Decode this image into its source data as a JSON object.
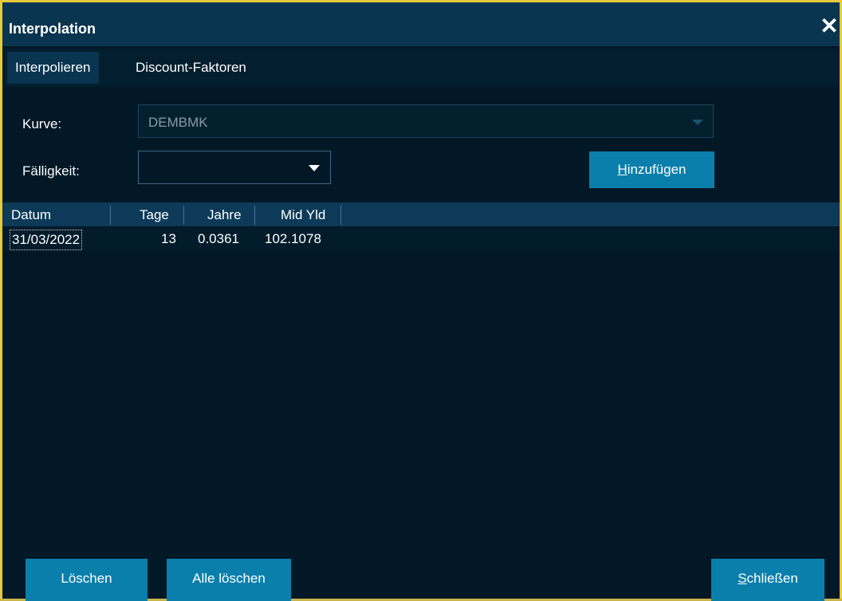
{
  "window": {
    "title": "Interpolation",
    "close_symbol": "✕"
  },
  "tabs": [
    {
      "label": "Interpolieren",
      "active": true
    },
    {
      "label": "Discount-Faktoren",
      "active": false
    }
  ],
  "form": {
    "kurve_label": "Kurve:",
    "kurve_value": "DEMBMK",
    "faelligkeit_label": "Fälligkeit:",
    "faelligkeit_value": "",
    "add_button": {
      "accel": "H",
      "rest": "inzufügen"
    }
  },
  "grid": {
    "columns": [
      "Datum",
      "Tage",
      "Jahre",
      "Mid Yld"
    ],
    "rows": [
      {
        "datum": "31/03/2022",
        "tage": "13",
        "jahre": "0.0361",
        "mid_yld": "102.1078"
      }
    ]
  },
  "footer": {
    "delete_label": "Löschen",
    "delete_all_label": "Alle löschen",
    "close_button": {
      "accel": "S",
      "rest": "chließen"
    }
  },
  "colors": {
    "window_border": "#e8c93a",
    "background": "#021826",
    "titlebar": "#0a3550",
    "button": "#0b7fab"
  }
}
